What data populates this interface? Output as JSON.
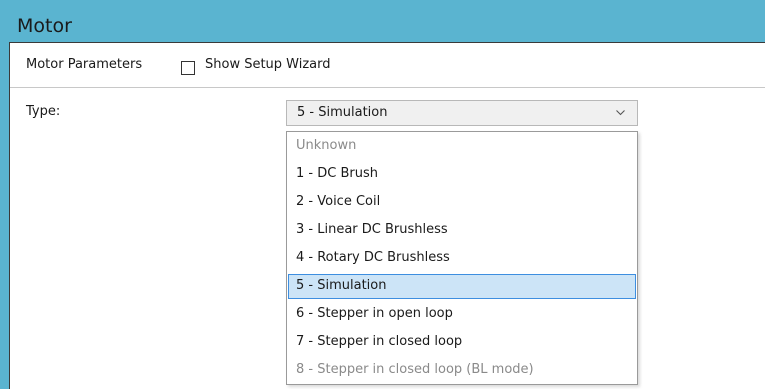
{
  "header": {
    "title": "Motor"
  },
  "toolbar": {
    "section_label": "Motor Parameters",
    "wizard_checkbox": {
      "label": "Show Setup Wizard",
      "checked": false
    }
  },
  "type_field": {
    "label": "Type:",
    "selected_value": "5 - Simulation",
    "icon": "chevron-down-icon"
  },
  "dropdown": {
    "options": [
      {
        "label": "Unknown",
        "disabled": true
      },
      {
        "label": "1 - DC Brush"
      },
      {
        "label": "2 - Voice Coil"
      },
      {
        "label": "3 - Linear DC Brushless"
      },
      {
        "label": "4 - Rotary DC Brushless"
      },
      {
        "label": "5 - Simulation",
        "selected": true
      },
      {
        "label": "6 - Stepper in open loop"
      },
      {
        "label": "7 - Stepper in closed loop"
      },
      {
        "label": "8 - Stepper in closed loop (BL mode)",
        "disabled": true
      }
    ]
  },
  "colors": {
    "header_bg": "#5ab4d0",
    "selection_bg": "#cce4f7",
    "selection_border": "#3d8ee0"
  }
}
